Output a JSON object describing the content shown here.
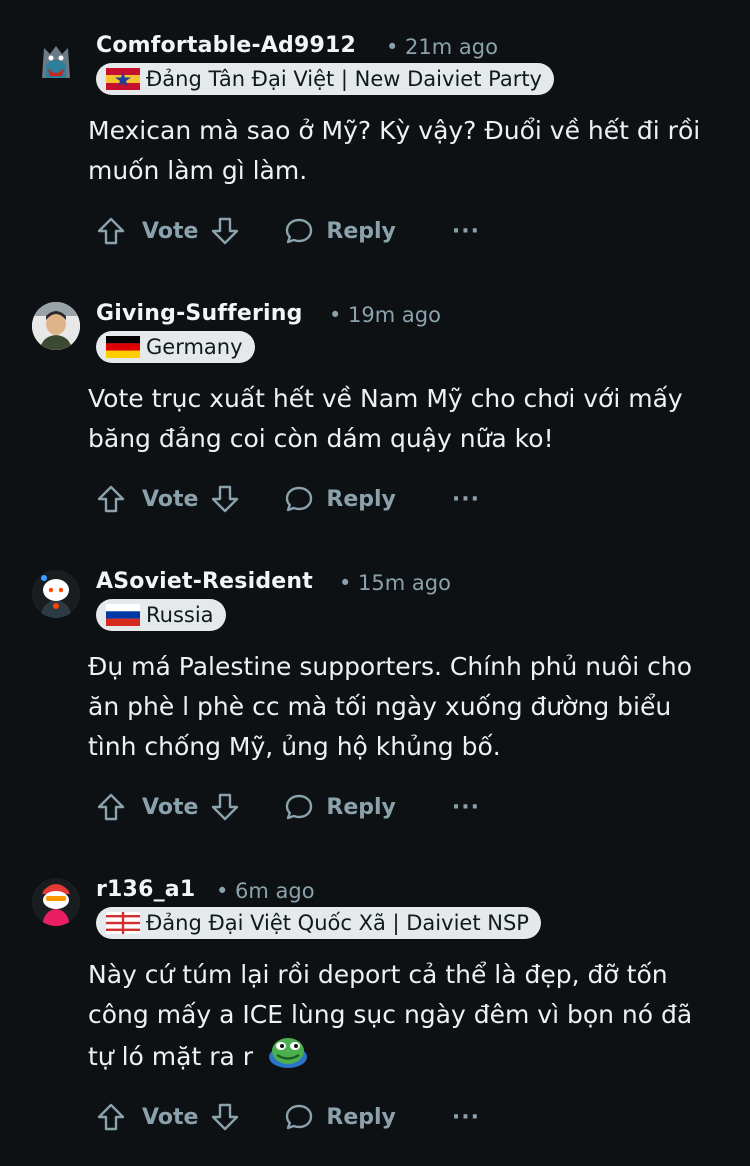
{
  "comments": [
    {
      "username": "Comfortable-Ad9912",
      "time": "• 21m ago",
      "flair": "Đảng Tân Đại Việt | New Daiviet Party",
      "flag": "new-daiviet-flag",
      "body": "Mexican mà sao ở Mỹ? Kỳ vậy? Đuổi về hết đi rồi muốn làm gì làm.",
      "vote_label": "Vote",
      "reply_label": "Reply",
      "more_label": "···"
    },
    {
      "username": "Giving-Suffering",
      "time": "• 19m ago",
      "flair": "Germany",
      "flag": "germany-flag",
      "body": "Vote trục xuất hết về Nam Mỹ cho chơi với mấy băng đảng coi còn dám quậy nữa ko!",
      "vote_label": "Vote",
      "reply_label": "Reply",
      "more_label": "···"
    },
    {
      "username": "ASoviet-Resident",
      "time": "• 15m ago",
      "flair": "Russia",
      "flag": "russia-flag",
      "body": "Đụ má Palestine supporters. Chính phủ nuôi cho ăn phè l phè cc mà tối ngày xuống đường biểu tình chống Mỹ, ủng hộ khủng bố.",
      "vote_label": "Vote",
      "reply_label": "Reply",
      "more_label": "···"
    },
    {
      "username": "r136_a1",
      "time": "• 6m ago",
      "flair": "Đảng Đại Việt Quốc Xã | Daiviet NSP",
      "flag": "daiviet-nsp-flag",
      "body": "Này cứ túm lại rồi deport cả thể là đẹp, đỡ tốn công mấy a ICE lùng sục ngày đêm vì bọn nó đã tự ló mặt ra r",
      "vote_label": "Vote",
      "reply_label": "Reply",
      "more_label": "···"
    }
  ],
  "colors": {
    "background": "#0e1113",
    "text": "#eef1f3",
    "muted": "#8ba2ad",
    "flair_bg": "#e5e9ec"
  }
}
